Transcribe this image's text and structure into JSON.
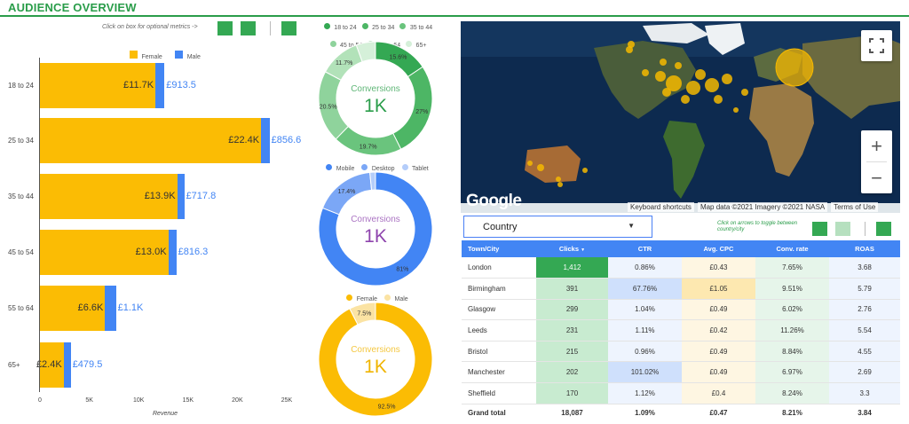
{
  "header": {
    "title": "AUDIENCE OVERVIEW",
    "hint": "Click on box for optional metrics ->"
  },
  "colors": {
    "accent": "#2a9d4a",
    "female": "#fbbc04",
    "male": "#4285f4",
    "table_header": "#4285f4"
  },
  "revenue_chart": {
    "legend": [
      "Female",
      "Male"
    ],
    "categories": [
      "18 to 24",
      "25 to 34",
      "35 to 44",
      "45 to 54",
      "55 to 64",
      "65+"
    ],
    "female_labels": [
      "£11.7K",
      "£22.4K",
      "£13.9K",
      "£13.0K",
      "£6.6K",
      "£2.4K"
    ],
    "male_labels": [
      "£913.5",
      "£856.6",
      "£717.8",
      "£816.3",
      "£1.1K",
      "£479.5"
    ],
    "ticks": [
      "0",
      "5K",
      "10K",
      "15K",
      "20K",
      "25K"
    ],
    "xlabel": "Revenue"
  },
  "chart_data": [
    {
      "type": "bar",
      "orientation": "horizontal",
      "stacked": true,
      "categories": [
        "18 to 24",
        "25 to 34",
        "35 to 44",
        "45 to 54",
        "55 to 64",
        "65+"
      ],
      "series": [
        {
          "name": "Female",
          "values": [
            11700,
            22400,
            13900,
            13000,
            6600,
            2400
          ]
        },
        {
          "name": "Male",
          "values": [
            913.5,
            856.6,
            717.8,
            816.3,
            1100,
            479.5
          ]
        }
      ],
      "xlabel": "Revenue",
      "xlim": [
        0,
        25000
      ],
      "legend": "top"
    },
    {
      "type": "pie",
      "center_label": "Conversions",
      "center_value": "1K",
      "labels": [
        "18 to 24",
        "25 to 34",
        "35 to 44",
        "45 to 54",
        "55 to 64",
        "65+"
      ],
      "values": [
        15.6,
        27,
        19.7,
        20.5,
        11.7,
        5.5
      ],
      "slice_labels": [
        "15.6%",
        "27%",
        "19.7%",
        "20.5%",
        "11.7%",
        ""
      ],
      "colors": [
        "#34a853",
        "#4db665",
        "#6ac47d",
        "#8fd39c",
        "#b2e2b9",
        "#d5f0d9"
      ]
    },
    {
      "type": "pie",
      "center_label": "Conversions",
      "center_value": "1K",
      "labels": [
        "Mobile",
        "Desktop",
        "Tablet"
      ],
      "values": [
        81,
        17.4,
        1.6
      ],
      "slice_labels": [
        "81%",
        "17.4%",
        ""
      ],
      "colors": [
        "#4285f4",
        "#7ba7f6",
        "#b4cdfa"
      ]
    },
    {
      "type": "pie",
      "center_label": "Conversions",
      "center_value": "1K",
      "labels": [
        "Female",
        "Male"
      ],
      "values": [
        92.5,
        7.5
      ],
      "slice_labels": [
        "92.5%",
        "7.5%"
      ],
      "colors": [
        "#fbbc04",
        "#fbe3a3"
      ]
    }
  ],
  "map": {
    "logo": "Google",
    "keyboard": "Keyboard shortcuts",
    "attribution": "Map data ©2021 Imagery ©2021 NASA",
    "terms": "Terms of Use",
    "fullscreen_icon": "fullscreen-icon",
    "zoom_in": "+",
    "zoom_out": "−"
  },
  "controls": {
    "dropdown_value": "Country",
    "arrows_hint": "Click on arrows to toggle between country/city"
  },
  "table": {
    "headers": [
      "Town/City",
      "Clicks",
      "CTR",
      "Avg. CPC",
      "Conv. rate",
      "ROAS"
    ],
    "sort_indicator": "▼",
    "rows": [
      [
        "London",
        "1,412",
        "0.86%",
        "£0.43",
        "7.65%",
        "3.68"
      ],
      [
        "Birmingham",
        "391",
        "67.76%",
        "£1.05",
        "9.51%",
        "5.79"
      ],
      [
        "Glasgow",
        "299",
        "1.04%",
        "£0.49",
        "6.02%",
        "2.76"
      ],
      [
        "Leeds",
        "231",
        "1.11%",
        "£0.42",
        "11.26%",
        "5.54"
      ],
      [
        "Bristol",
        "215",
        "0.96%",
        "£0.49",
        "8.84%",
        "4.55"
      ],
      [
        "Manchester",
        "202",
        "101.02%",
        "£0.49",
        "6.97%",
        "2.69"
      ],
      [
        "Sheffield",
        "170",
        "1.12%",
        "£0.4",
        "8.24%",
        "3.3"
      ]
    ],
    "total": [
      "Grand total",
      "18,087",
      "1.09%",
      "£0.47",
      "8.21%",
      "3.84"
    ]
  }
}
